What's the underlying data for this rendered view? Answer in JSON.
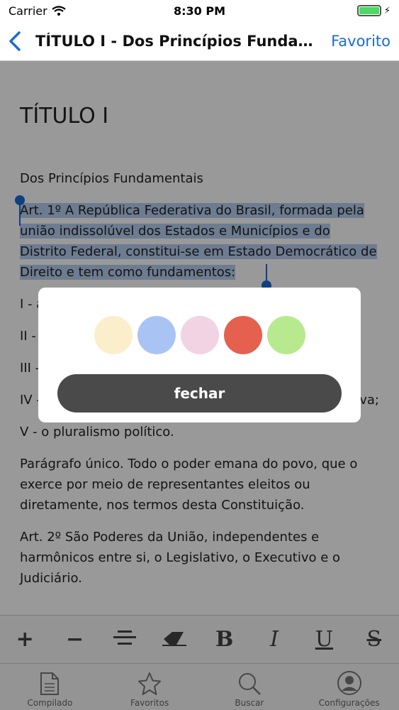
{
  "status_bar": {
    "carrier": "Carrier",
    "time": "8:30 PM"
  },
  "nav": {
    "title": "TÍTULO I - Dos Princípios Fundam...",
    "favorite": "Favorito"
  },
  "document": {
    "title": "TÍTULO I",
    "subtitle": "Dos Princípios Fundamentais",
    "paragraphs": [
      "Art. 1º A República Federativa do Brasil, formada pela união indissolúvel dos Estados e Municípios e do Distrito Federal, constitui-se em Estado Democrático de Direito e tem como fundamentos:",
      "I - a",
      "II -",
      "III -",
      "IV -",
      "V - o pluralismo político.",
      "Parágrafo único. Todo o poder emana do povo, que o exerce por meio de representantes eleitos ou diretamente, nos termos desta Constituição.",
      "Art. 2º São Poderes da União, independentes e harmônicos entre si, o Legislativo, o Executivo e o Judiciário."
    ],
    "fragment_right": "va;"
  },
  "toolbar": {
    "items": [
      {
        "icon": "plus-icon",
        "label": "+"
      },
      {
        "icon": "minus-icon",
        "label": "−"
      },
      {
        "icon": "align-center-icon",
        "label": ""
      },
      {
        "icon": "eraser-icon",
        "label": ""
      },
      {
        "icon": "bold-icon",
        "label": "B"
      },
      {
        "icon": "italic-icon",
        "label": "I"
      },
      {
        "icon": "underline-icon",
        "label": "U"
      },
      {
        "icon": "strikethrough-icon",
        "label": "S"
      }
    ]
  },
  "tabs": [
    {
      "label": "Compilado",
      "icon": "document-icon"
    },
    {
      "label": "Favoritos",
      "icon": "star-icon"
    },
    {
      "label": "Buscar",
      "icon": "search-icon"
    },
    {
      "label": "Configurações",
      "icon": "user-icon"
    }
  ],
  "modal": {
    "colors": [
      "#fbeecb",
      "#a9c4f4",
      "#f1d3e3",
      "#e5604e",
      "#b7ea8e"
    ],
    "close_label": "fechar"
  },
  "accent": "#1a6bd6"
}
